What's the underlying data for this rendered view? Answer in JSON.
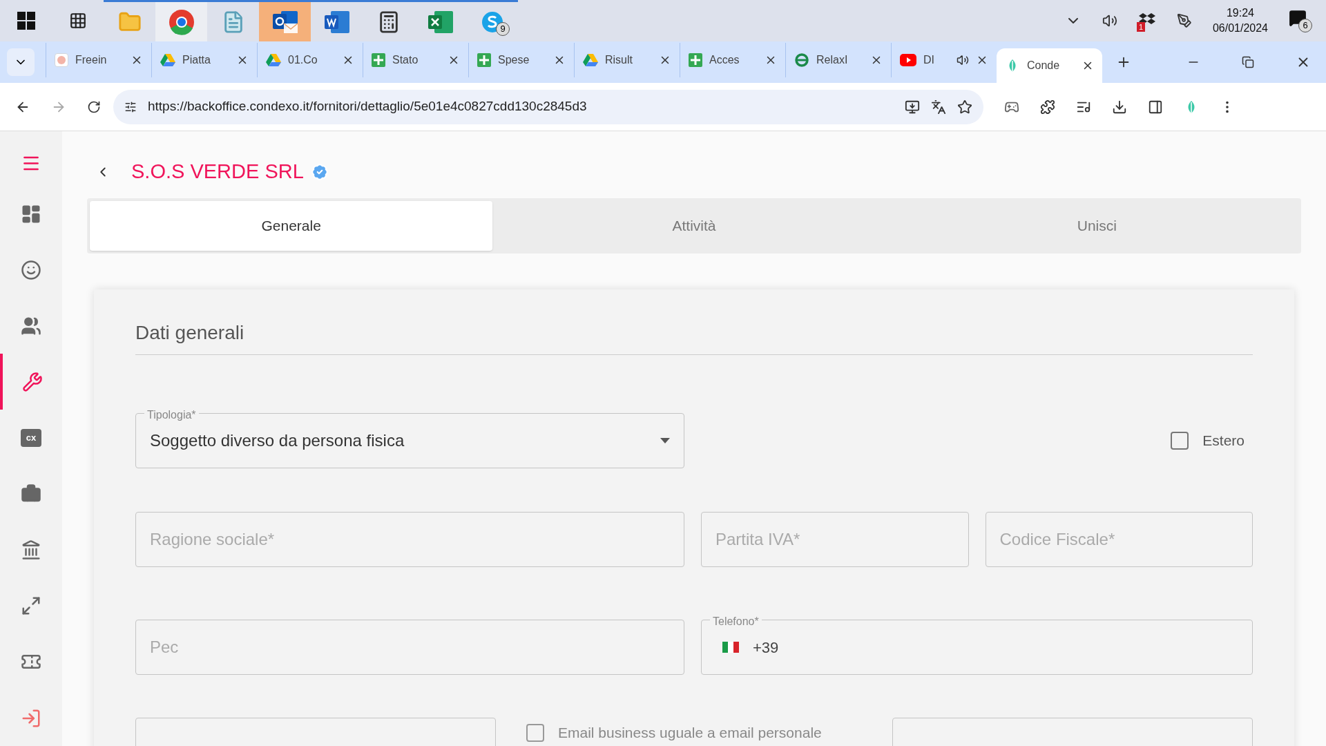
{
  "taskbar": {
    "apps": [
      {
        "kind": "start",
        "active": false
      },
      {
        "kind": "taskview",
        "active": false
      },
      {
        "kind": "folder",
        "active": true
      },
      {
        "kind": "chrome",
        "active": true
      },
      {
        "kind": "notepad",
        "active": true
      },
      {
        "kind": "outlook",
        "active": true
      },
      {
        "kind": "word",
        "active": true
      },
      {
        "kind": "calculator",
        "active": true
      },
      {
        "kind": "excel",
        "active": true
      },
      {
        "kind": "skype",
        "active": true,
        "badge": "9"
      }
    ],
    "tray": {
      "time": "19:24",
      "date": "06/01/2024",
      "dropbox_badge": "1",
      "notifications": "6"
    }
  },
  "browser": {
    "tabs": [
      {
        "title": "Freein",
        "kind": "app",
        "selected": false
      },
      {
        "title": "Piatta",
        "kind": "drive",
        "selected": false
      },
      {
        "title": "01.Co",
        "kind": "drive",
        "selected": false
      },
      {
        "title": "Stato",
        "kind": "sheets",
        "selected": false
      },
      {
        "title": "Spese",
        "kind": "sheets",
        "selected": false
      },
      {
        "title": "Risult",
        "kind": "drive",
        "selected": false
      },
      {
        "title": "Acces",
        "kind": "sheets",
        "selected": false
      },
      {
        "title": "RelaxI",
        "kind": "relax",
        "selected": false
      },
      {
        "title": "DI",
        "kind": "youtube",
        "selected": false,
        "audio": true
      },
      {
        "title": "Conde",
        "kind": "condexo",
        "selected": true
      }
    ],
    "url": "https://backoffice.condexo.it/fornitori/dettaglio/5e01e4c0827cdd130c2845d3"
  },
  "sidebar": {
    "items": [
      {
        "kind": "dashboard",
        "selected": false
      },
      {
        "kind": "face",
        "selected": false
      },
      {
        "kind": "people",
        "selected": false
      },
      {
        "kind": "wrench",
        "selected": true
      },
      {
        "kind": "cx",
        "selected": false
      },
      {
        "kind": "briefcase",
        "selected": false
      },
      {
        "kind": "bank",
        "selected": false
      },
      {
        "kind": "arrows",
        "selected": false
      },
      {
        "kind": "ticket",
        "selected": false
      },
      {
        "kind": "logout",
        "selected": false
      }
    ]
  },
  "page": {
    "title": "S.O.S VERDE SRL",
    "verified": true,
    "tabs": [
      {
        "label": "Generale",
        "selected": true
      },
      {
        "label": "Attività",
        "selected": false
      },
      {
        "label": "Unisci",
        "selected": false
      }
    ],
    "section_title": "Dati generali",
    "tipologia": {
      "label": "Tipologia*",
      "value": "Soggetto diverso da persona fisica"
    },
    "estero": {
      "label": "Estero",
      "checked": false
    },
    "ragione_sociale": {
      "placeholder": "Ragione sociale*"
    },
    "partita_iva": {
      "placeholder": "Partita IVA*"
    },
    "codice_fiscale": {
      "placeholder": "Codice Fiscale*"
    },
    "pec": {
      "placeholder": "Pec"
    },
    "telefono": {
      "label": "Telefono*",
      "value": "+39"
    },
    "email_same": {
      "label": "Email business uguale a email personale",
      "checked": false
    }
  }
}
